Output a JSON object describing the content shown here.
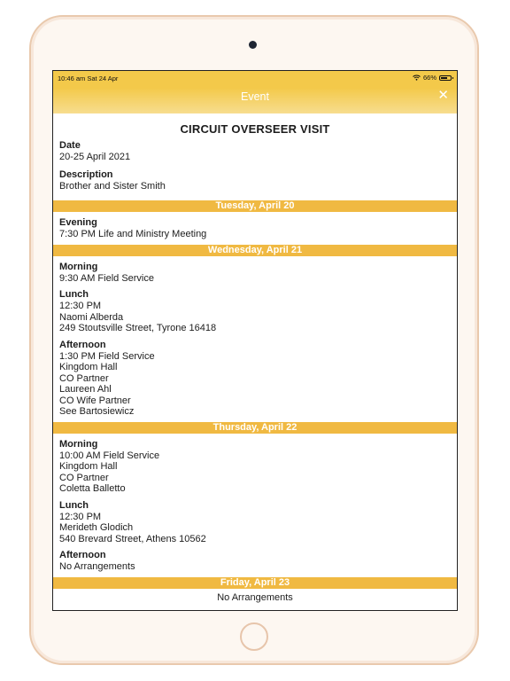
{
  "status_bar": {
    "time": "10:46 am  Sat 24 Apr",
    "battery": "66%",
    "battery_level": 0.66
  },
  "nav": {
    "title": "Event",
    "close": "✕"
  },
  "event": {
    "title": "CIRCUIT OVERSEER VISIT",
    "date_label": "Date",
    "date_value": "20-25 April 2021",
    "description_label": "Description",
    "description_value": "Brother and Sister Smith"
  },
  "days": [
    {
      "header": "Tuesday, April 20",
      "sections": [
        {
          "label": "Evening",
          "lines": [
            "7:30 PM Life and Ministry Meeting"
          ]
        }
      ]
    },
    {
      "header": "Wednesday, April 21",
      "sections": [
        {
          "label": "Morning",
          "lines": [
            "9:30 AM Field Service"
          ]
        },
        {
          "label": "Lunch",
          "lines": [
            "12:30 PM",
            "Naomi Alberda",
            "249 Stoutsville Street, Tyrone 16418"
          ]
        },
        {
          "label": "Afternoon",
          "lines": [
            "1:30 PM Field Service",
            "Kingdom Hall",
            "CO Partner",
            "Laureen Ahl",
            "CO Wife Partner",
            "See Bartosiewicz"
          ]
        }
      ]
    },
    {
      "header": "Thursday, April 22",
      "sections": [
        {
          "label": "Morning",
          "lines": [
            "10:00 AM Field Service",
            "Kingdom Hall",
            "CO Partner",
            "Coletta Balletto"
          ]
        },
        {
          "label": "Lunch",
          "lines": [
            "12:30 PM",
            "Merideth Glodich",
            "540 Brevard Street, Athens 10562"
          ]
        },
        {
          "label": "Afternoon",
          "lines": [
            "No Arrangements"
          ]
        }
      ]
    },
    {
      "header": "Friday, April 23",
      "note": "No Arrangements"
    }
  ],
  "colors": {
    "header_gold": "#f3c94a",
    "day_band": "#f0b942"
  }
}
